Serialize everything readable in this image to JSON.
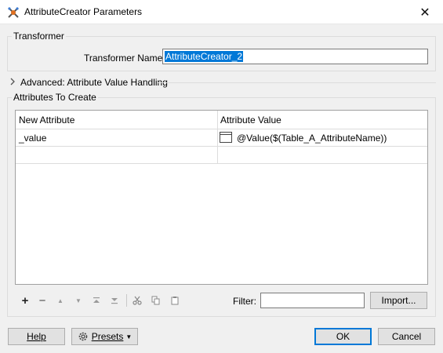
{
  "window": {
    "title": "AttributeCreator Parameters"
  },
  "transformer_group": {
    "title": "Transformer",
    "name_label": "Transformer Name:",
    "name_value": "AttributeCreator_2"
  },
  "advanced": {
    "label": "Advanced: Attribute Value Handling"
  },
  "attributes_group": {
    "title": "Attributes To Create",
    "columns": [
      "New Attribute",
      "Attribute Value"
    ],
    "rows": [
      {
        "new_attribute": "_value",
        "attribute_value": "@Value($(Table_A_AttributeName))"
      },
      {
        "new_attribute": "",
        "attribute_value": ""
      }
    ]
  },
  "filter": {
    "label": "Filter:",
    "value": ""
  },
  "buttons": {
    "import": "Import...",
    "help": "Help",
    "presets": "Presets",
    "ok": "OK",
    "cancel": "Cancel"
  }
}
